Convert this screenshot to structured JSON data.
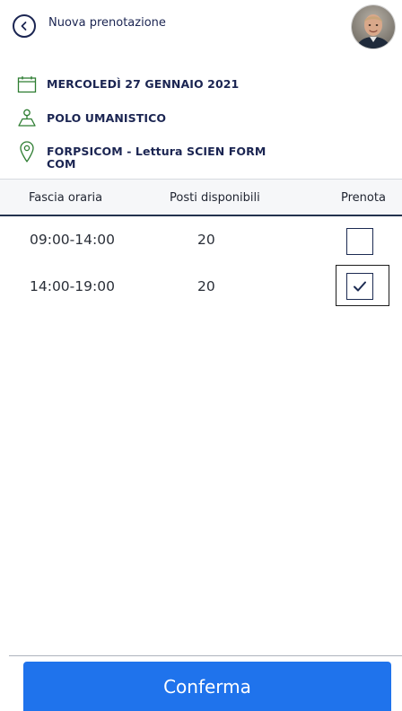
{
  "header": {
    "title": "Nuova prenotazione"
  },
  "info": {
    "date": "MERCOLEDÌ 27 GENNAIO 2021",
    "location": "POLO UMANISTICO",
    "room_line1": "FORPSICOM - Lettura SCIEN FORM",
    "room_line2": "COM"
  },
  "table": {
    "columns": [
      "Fascia oraria",
      "Posti disponibili",
      "Prenota"
    ],
    "rows": [
      {
        "time_slot": "09:00-14:00",
        "available": "20",
        "booked": false
      },
      {
        "time_slot": "14:00-19:00",
        "available": "20",
        "booked": true
      }
    ]
  },
  "footer": {
    "confirm_label": "Conferma"
  },
  "colors": {
    "primary": "#1f73ec",
    "text_dark": "#1b2552",
    "accent_icon": "#2e7d32"
  }
}
